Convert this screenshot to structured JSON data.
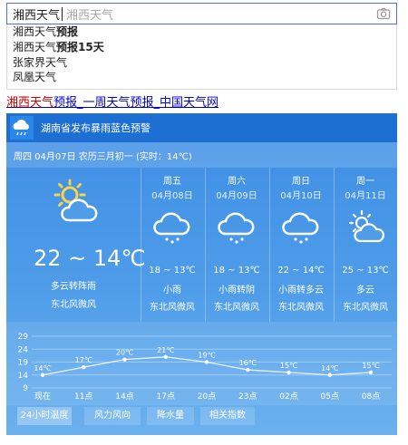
{
  "search": {
    "query": "湘西天气",
    "placeholder": "湘西天气"
  },
  "suggestions": [
    {
      "prefix": "湘西天气",
      "rest": "预报"
    },
    {
      "prefix": "湘西天气",
      "rest": "预报15天"
    },
    {
      "prefix": "",
      "rest": "张家界天气"
    },
    {
      "prefix": "",
      "rest": "凤凰天气"
    }
  ],
  "result": {
    "title_hl": "湘西天气",
    "title_rest": "预报_一周天气预报_中国天气网"
  },
  "weather": {
    "alert": "湖南省发布暴雨蓝色预警",
    "date_line": "周四 04月07日 农历三月初一 (实时：14℃)",
    "today": {
      "temp": "22 ~ 14℃",
      "desc": "多云转阵雨",
      "wind": "东北风微风"
    },
    "days": [
      {
        "name": "周五",
        "date": "04月08日",
        "temp": "18 ~ 13℃",
        "desc": "小雨",
        "wind": "东北风微风",
        "icon": "rain-icon"
      },
      {
        "name": "周六",
        "date": "04月09日",
        "temp": "18 ~ 13℃",
        "desc": "小雨转阴",
        "wind": "东北风微风",
        "icon": "rain-icon"
      },
      {
        "name": "周日",
        "date": "04月10日",
        "temp": "22 ~ 14℃",
        "desc": "小雨转多云",
        "wind": "东北风微风",
        "icon": "rain-icon"
      },
      {
        "name": "周一",
        "date": "04月11日",
        "temp": "25 ~ 13℃",
        "desc": "多云",
        "wind": "东北风微风",
        "icon": "partly-cloudy-icon"
      }
    ],
    "tabs": [
      "24小时温度",
      "风力风向",
      "降水量",
      "相关指数"
    ],
    "active_tab": 0
  },
  "chart_data": {
    "type": "line",
    "x": [
      "现在",
      "11点",
      "14点",
      "17点",
      "20点",
      "23点",
      "02点",
      "05点",
      "08点"
    ],
    "values": [
      14,
      17,
      20,
      21,
      19,
      16,
      15,
      14,
      15
    ],
    "point_labels": [
      "14℃",
      "17℃",
      "20℃",
      "21℃",
      "19℃",
      "16℃",
      "15℃",
      "14℃",
      "15℃"
    ],
    "yticks": [
      29,
      24,
      19,
      14,
      9
    ],
    "ylim": [
      9,
      29
    ],
    "grid": true
  }
}
